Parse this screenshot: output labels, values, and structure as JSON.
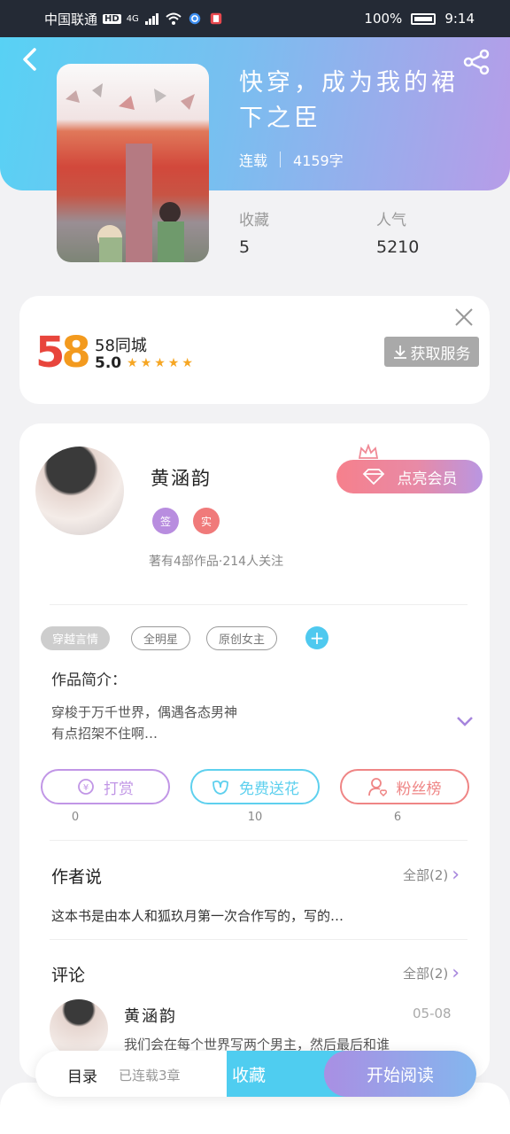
{
  "status_bar": {
    "carrier": "中国联通",
    "hd": "HD",
    "network": "4G",
    "battery": "100%",
    "time": "9:14"
  },
  "book": {
    "title": "快穿，成为我的裙下之臣",
    "status": "连载",
    "word_count": "4159字",
    "stats": [
      {
        "label": "收藏",
        "value": "5"
      },
      {
        "label": "人气",
        "value": "5210"
      }
    ]
  },
  "ad": {
    "logo_text": "58",
    "name": "58同城",
    "rating": "5.0",
    "stars": 5,
    "button_label": "获取服务"
  },
  "author": {
    "name": "黄涵韵",
    "badges": [
      {
        "text": "签",
        "color": "#b88ddf"
      },
      {
        "text": "实",
        "color": "#f07a7a"
      }
    ],
    "stats": "著有4部作品·214人关注",
    "vip_label": "点亮会员"
  },
  "tags": [
    "穿越言情",
    "全明星",
    "原创女主"
  ],
  "intro": {
    "title": "作品简介：",
    "text_line1": "穿梭于万千世界，偶遇各态男神",
    "text_line2": "有点招架不住啊…"
  },
  "actions": [
    {
      "label": "打赏",
      "count": "0",
      "color": "#c196e6"
    },
    {
      "label": "免费送花",
      "count": "10",
      "color": "#5ed0ee"
    },
    {
      "label": "粉丝榜",
      "count": "6",
      "color": "#ef8585"
    }
  ],
  "author_say": {
    "title": "作者说",
    "more": "全部(2)",
    "text": "这本书是由本人和狐玖月第一次合作写的，写的…"
  },
  "comments": {
    "title": "评论",
    "more": "全部(2)",
    "items": [
      {
        "name": "黄涵韵",
        "date": "05-08",
        "text": "我们会在每个世界写两个男主，然后最后和谁"
      }
    ]
  },
  "bottom_bar": {
    "toc": "目录",
    "toc_status": "已连载3章",
    "favorite": "收藏",
    "read": "开始阅读"
  }
}
